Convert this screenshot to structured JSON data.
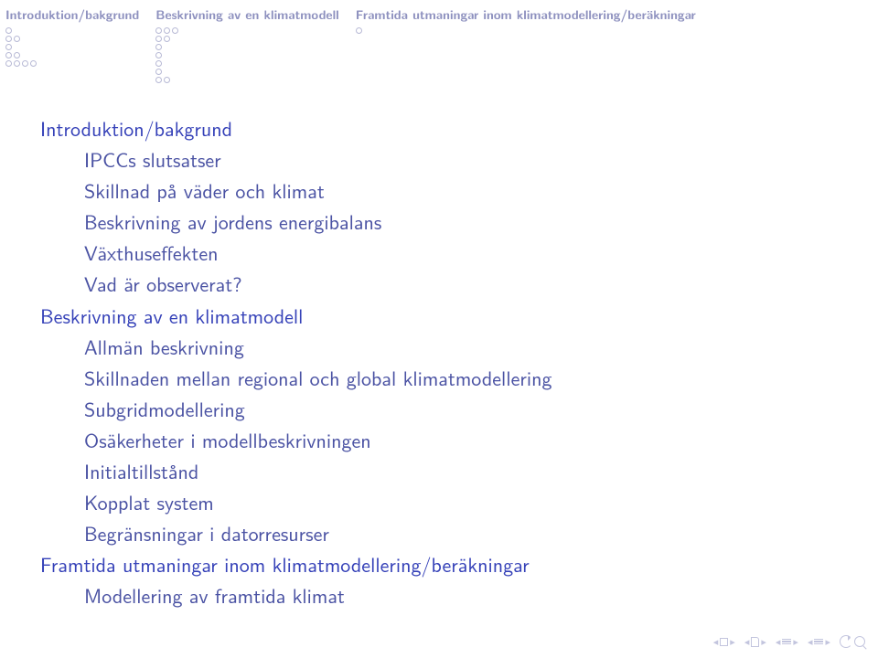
{
  "header": {
    "sections": [
      {
        "title": "Introduktion/bakgrund",
        "rows": [
          1,
          2,
          1,
          2,
          4
        ]
      },
      {
        "title": "Beskrivning av en klimatmodell",
        "rows": [
          3,
          2,
          1,
          1,
          1,
          1,
          2
        ]
      },
      {
        "title": "Framtida utmaningar inom klimatmodellering/beräkningar",
        "rows": [
          1
        ]
      }
    ]
  },
  "outline": [
    {
      "type": "section",
      "text": "Introduktion/bakgrund"
    },
    {
      "type": "sub",
      "text": "IPCCs slutsatser"
    },
    {
      "type": "sub",
      "text": "Skillnad på väder och klimat"
    },
    {
      "type": "sub",
      "text": "Beskrivning av jordens energibalans"
    },
    {
      "type": "sub",
      "text": "Växthuseffekten"
    },
    {
      "type": "sub",
      "text": "Vad är observerat?"
    },
    {
      "type": "section",
      "text": "Beskrivning av en klimatmodell"
    },
    {
      "type": "sub",
      "text": "Allmän beskrivning"
    },
    {
      "type": "sub",
      "text": "Skillnaden mellan regional och global klimatmodellering"
    },
    {
      "type": "sub",
      "text": "Subgridmodellering"
    },
    {
      "type": "sub",
      "text": "Osäkerheter i modellbeskrivningen"
    },
    {
      "type": "sub",
      "text": "Initialtillstånd"
    },
    {
      "type": "sub",
      "text": "Kopplat system"
    },
    {
      "type": "sub",
      "text": "Begränsningar i datorresurser"
    },
    {
      "type": "section",
      "text": "Framtida utmaningar inom klimatmodellering/beräkningar"
    },
    {
      "type": "sub",
      "text": "Modellering av framtida klimat"
    }
  ]
}
